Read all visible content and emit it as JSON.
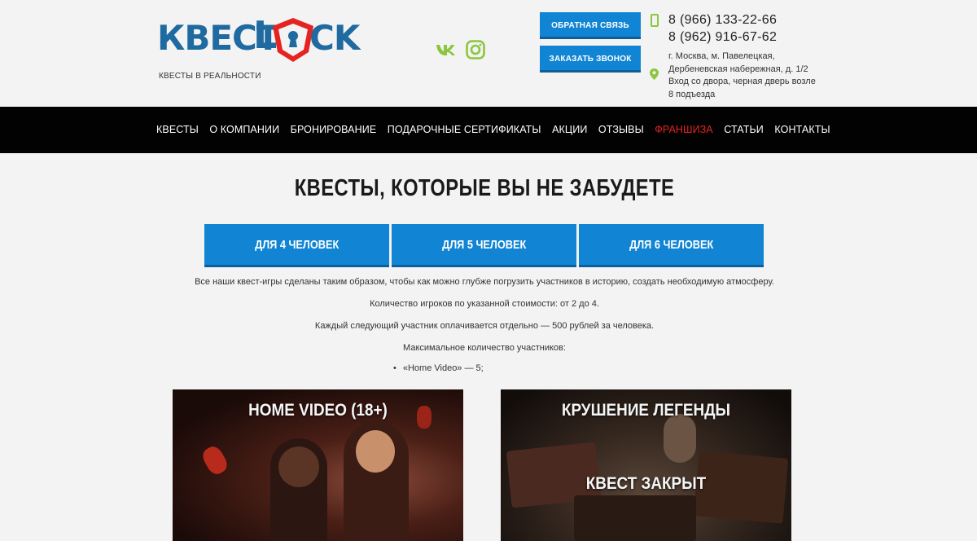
{
  "header": {
    "logo_left": "КВЕСТ",
    "logo_l": "L",
    "logo_right": "CK",
    "tagline": "КВЕСТЫ В РЕАЛЬНОСТИ",
    "feedback_button": "ОБРАТНАЯ СВЯЗЬ",
    "callback_button": "ЗАКАЗАТЬ ЗВОНОК",
    "phones": [
      "8 (966) 133-22-66",
      "8 (962) 916-67-62"
    ],
    "address": "г. Москва, м. Павелецкая, Дербеневская набережная, д. 1/2 Вход со двора, черная дверь возле 8 подъезда"
  },
  "social": [
    "vk-icon",
    "instagram-icon"
  ],
  "nav": {
    "items": [
      {
        "label": "КВЕСТЫ"
      },
      {
        "label": "О КОМПАНИИ"
      },
      {
        "label": "БРОНИРОВАНИЕ"
      },
      {
        "label": "ПОДАРОЧНЫЕ СЕРТИФИКАТЫ"
      },
      {
        "label": "АКЦИИ"
      },
      {
        "label": "ОТЗЫВЫ"
      },
      {
        "label": "ФРАНШИЗА"
      },
      {
        "label": "СТАТЬИ"
      },
      {
        "label": "КОНТАКТЫ"
      }
    ]
  },
  "main": {
    "title": "КВЕСТЫ, КОТОРЫЕ ВЫ НЕ ЗАБУДЕТЕ",
    "tabs": [
      "ДЛЯ 4 ЧЕЛОВЕК",
      "ДЛЯ 5 ЧЕЛОВЕК",
      "ДЛЯ 6 ЧЕЛОВЕК"
    ],
    "paragraphs": [
      "Все наши квест-игры сделаны таким образом, чтобы как можно глубже погрузить участников в историю, создать необходимую атмосферу.",
      "Количество игроков по указанной стоимости: от 2 до 4.",
      "Каждый следующий участник оплачивается отдельно — 500 рублей за человека.",
      "Максимальное количество участников:"
    ],
    "bullet": "«Home Video» — 5;"
  },
  "cards": [
    {
      "title": "HOME VIDEO (18+)",
      "status": ""
    },
    {
      "title": "КРУШЕНИЕ ЛЕГЕНДЫ",
      "status": "КВЕСТ ЗАКРЫТ"
    }
  ],
  "colors": {
    "accent": "#1185d4",
    "nav_bg": "#020202",
    "nav_highlight": "#e52320",
    "logo_blue": "#1f6aa0",
    "logo_red": "#e52320",
    "icon_green": "#8cc63f"
  }
}
